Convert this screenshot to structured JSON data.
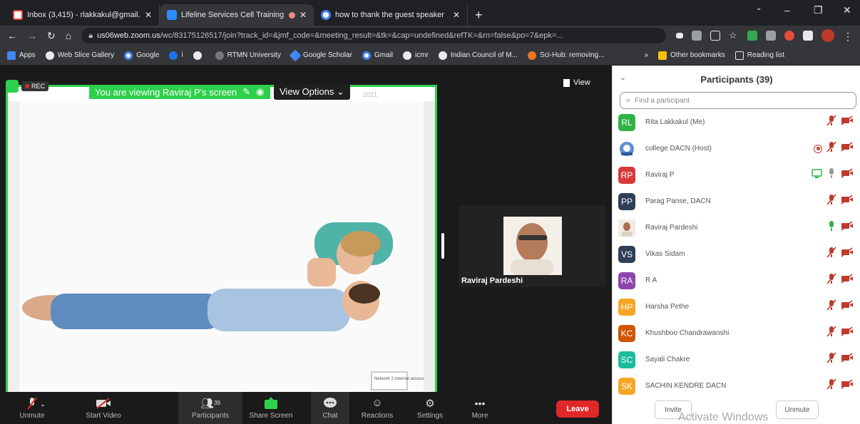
{
  "tabs": [
    {
      "title": "Inbox (3,415) - rlakkakul@gmail.",
      "favicon": "gmail-icon",
      "color": "#ea4335"
    },
    {
      "title": "Lifeline Services Cell Training",
      "favicon": "zoom-icon",
      "color": "#2d8cff",
      "active": true
    },
    {
      "title": "how to thank the guest speaker",
      "favicon": "google-icon",
      "color": "#4285f4"
    }
  ],
  "new_tab": "+",
  "window_controls": {
    "minimize": "–",
    "restore": "❐",
    "close": "✕"
  },
  "address": {
    "domain": "us06web.zoom.us",
    "path": "/wc/83175126517/join?track_id=&jmf_code=&meeting_result=&tk=&cap=undefined&refTK=&rn=false&po=7&epk=..."
  },
  "bookmarks": [
    {
      "label": "Apps",
      "color": "#4285f4"
    },
    {
      "label": "Web Slice Gallery",
      "color": "#e8eaed"
    },
    {
      "label": "Google",
      "color": "#4285f4"
    },
    {
      "label": "i",
      "color": "#1a73e8"
    },
    {
      "label": "",
      "color": "#e8eaed"
    },
    {
      "label": "RTMN University",
      "color": "#777"
    },
    {
      "label": "Google Scholar",
      "color": "#4285f4"
    },
    {
      "label": "Gmail",
      "color": "#4285f4"
    },
    {
      "label": "icmr",
      "color": "#e8eaed"
    },
    {
      "label": "Indian Council of M...",
      "color": "#e8eaed"
    },
    {
      "label": "Sci-Hub: removing...",
      "color": "#e87722"
    }
  ],
  "bookmarks_more": "»",
  "bookmarks_right": [
    "Other bookmarks",
    "Reading list"
  ],
  "share": {
    "rec": "REC",
    "banner": "You are viewing Raviraj P's screen",
    "view_options": "View Options ⌄",
    "faded_text": "2021",
    "slide_note": "Network 2 Internet access"
  },
  "view_button": "View",
  "video": {
    "name": "Raviraj Pardeshi"
  },
  "toolbar": [
    {
      "label": "Unmute",
      "icon": "mic-muted-icon"
    },
    {
      "label": "Start Video",
      "icon": "video-off-icon"
    },
    {
      "label": "Participants",
      "icon": "participants-icon",
      "count": "39",
      "selected": true
    },
    {
      "label": "Share Screen",
      "icon": "share-screen-icon"
    },
    {
      "label": "Chat",
      "icon": "chat-icon"
    },
    {
      "label": "Reactions",
      "icon": "reactions-icon"
    },
    {
      "label": "Settings",
      "icon": "gear-icon"
    },
    {
      "label": "More",
      "icon": "more-icon"
    }
  ],
  "leave": "Leave",
  "participants": {
    "title": "Participants (39)",
    "search_placeholder": "Find a participant",
    "list": [
      {
        "initials": "RL",
        "name": "Rita Lakkakul (Me)",
        "color": "#2fb344",
        "mic": "muted",
        "cam": "off"
      },
      {
        "initials": "",
        "name": "college DACN (Host)",
        "color": "#5b8fd6",
        "mic": "muted",
        "cam": "off",
        "record": true,
        "avatar": "logo"
      },
      {
        "initials": "RP",
        "name": "Raviraj P",
        "color": "#d93a3a",
        "mic": "on",
        "cam": "off",
        "sharing": true
      },
      {
        "initials": "PP",
        "name": "Parag Panse, DACN",
        "color": "#2e3f57",
        "mic": "muted",
        "cam": "off"
      },
      {
        "initials": "",
        "name": "Raviraj Pardeshi",
        "color": "#8a6a50",
        "mic": "active",
        "cam": "off",
        "avatar": "photo"
      },
      {
        "initials": "VS",
        "name": "Vikas Sidam",
        "color": "#2e3f57",
        "mic": "muted",
        "cam": "off"
      },
      {
        "initials": "RA",
        "name": "R A",
        "color": "#8e44ad",
        "mic": "muted",
        "cam": "off"
      },
      {
        "initials": "HP",
        "name": "Harsha Pethe",
        "color": "#f5a623",
        "mic": "muted",
        "cam": "off"
      },
      {
        "initials": "KC",
        "name": "Khushboo Chandrawanshi",
        "color": "#d35400",
        "mic": "muted",
        "cam": "off"
      },
      {
        "initials": "SC",
        "name": "Sayali Chakre",
        "color": "#1abc9c",
        "mic": "muted",
        "cam": "off"
      },
      {
        "initials": "SK",
        "name": "SACHIN KENDRE DACN",
        "color": "#f5a623",
        "mic": "muted",
        "cam": "off"
      }
    ],
    "invite": "Invite",
    "unmute": "Unmute"
  },
  "watermark": "Activate Windows"
}
